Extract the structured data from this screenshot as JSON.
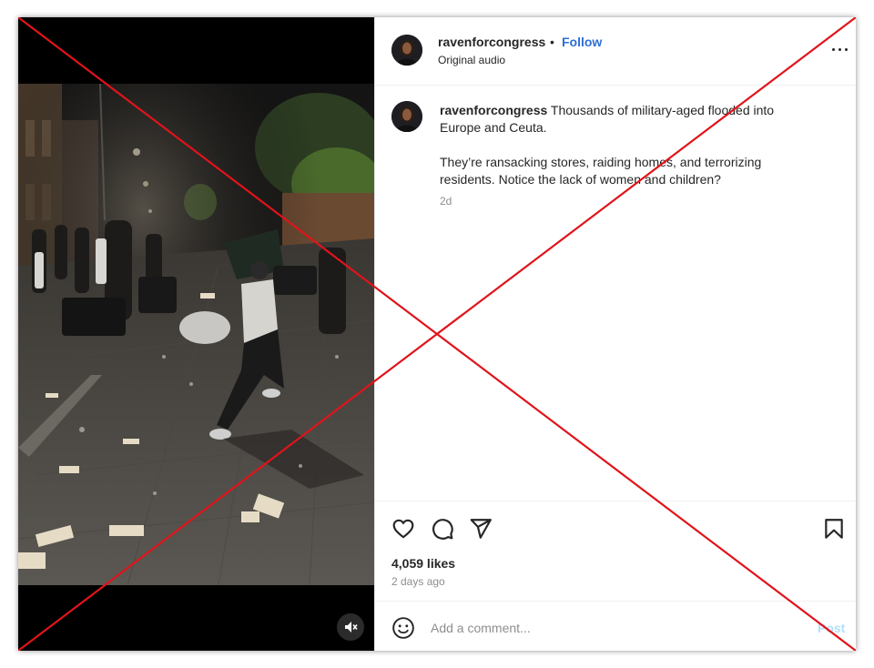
{
  "post": {
    "username": "ravenforcongress",
    "separator": "•",
    "follow_label": "Follow",
    "audio_label": "Original audio",
    "caption_username": "ravenforcongress",
    "caption_line1": "Thousands of military-aged flooded into Europe and Ceuta.",
    "caption_line2": "They’re ransacking stores, raiding homes, and terrorizing residents. Notice the lack of women and children?",
    "caption_time": "2d",
    "likes": "4,059 likes",
    "posted": "2 days ago"
  },
  "comment": {
    "placeholder": "Add a comment...",
    "post_label": "Post"
  },
  "icons": {
    "more": "more-options-icon",
    "like": "heart-icon",
    "comment": "comment-icon",
    "share": "share-icon",
    "save": "bookmark-icon",
    "emoji": "emoji-icon",
    "mute": "muted-speaker-icon"
  },
  "colors": {
    "follow": "#2f6fd6",
    "cross_lines": "#e0141a",
    "post_button_disabled": "#b2dffc"
  }
}
